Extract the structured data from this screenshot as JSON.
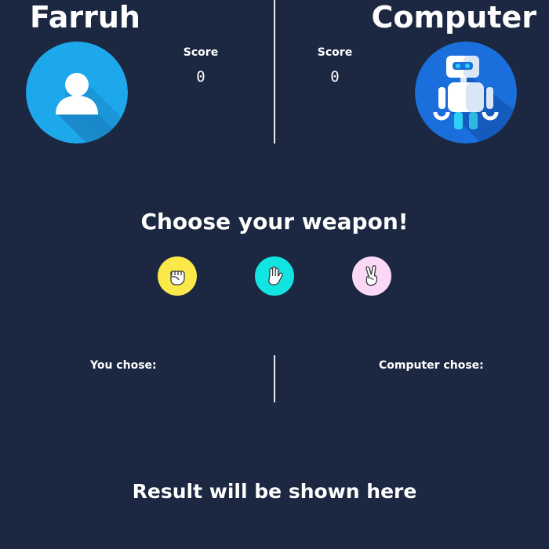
{
  "player": {
    "name": "Farruh",
    "score_label": "Score",
    "score": "0",
    "avatar_icon": "user-avatar-icon",
    "avatar_color": "#1ea8ec"
  },
  "computer": {
    "name": "Computer",
    "score_label": "Score",
    "score": "0",
    "avatar_icon": "robot-avatar-icon",
    "avatar_color": "#1a6fdc"
  },
  "game": {
    "prompt": "Choose your weapon!",
    "weapons": [
      {
        "name": "rock",
        "icon": "fist-icon",
        "color": "#fbe94a"
      },
      {
        "name": "paper",
        "icon": "open-hand-icon",
        "color": "#12e4e2"
      },
      {
        "name": "scissors",
        "icon": "peace-hand-icon",
        "color": "#fbd8f6"
      }
    ],
    "you_chose_label": "You chose:",
    "computer_chose_label": "Computer chose:",
    "result_text": "Result will be shown here"
  },
  "colors": {
    "background": "#1c2841",
    "text": "#ffffff",
    "divider": "#e6e9ef"
  }
}
